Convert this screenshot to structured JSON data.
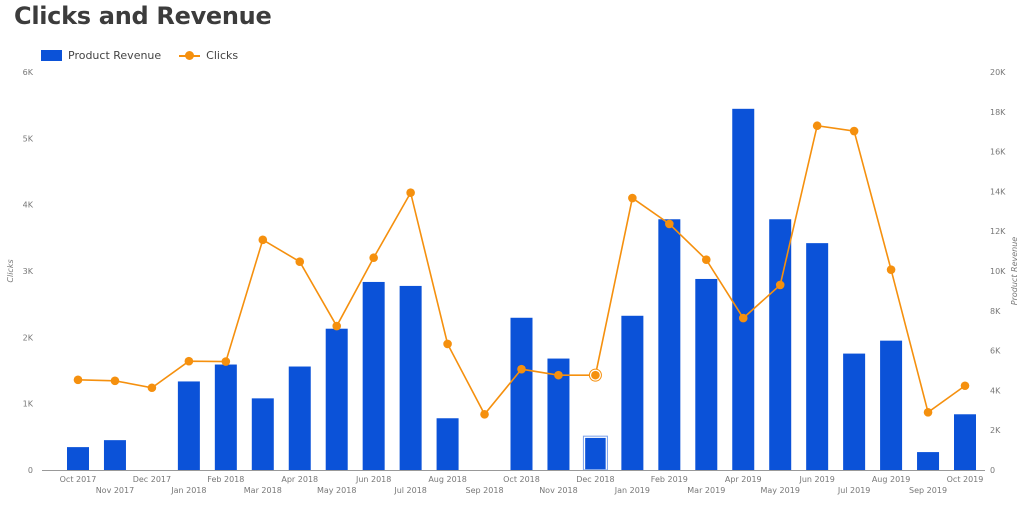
{
  "chart_data": {
    "type": "bar+line",
    "title": "Clicks and Revenue",
    "categories": [
      "Oct 2017",
      "Nov 2017",
      "Dec 2017",
      "Jan 2018",
      "Feb 2018",
      "Mar 2018",
      "Apr 2018",
      "May 2018",
      "Jun 2018",
      "Jul 2018",
      "Aug 2018",
      "Sep 2018",
      "Oct 2018",
      "Nov 2018",
      "Dec 2018",
      "Jan 2019",
      "Feb 2019",
      "Mar 2019",
      "Apr 2019",
      "May 2019",
      "Jun 2019",
      "Jul 2019",
      "Aug 2019",
      "Sep 2019",
      "Oct 2019"
    ],
    "series": [
      {
        "name": "Product Revenue",
        "type": "bar",
        "axis": "right",
        "color": "#0b52d8",
        "values": [
          1150,
          1500,
          0,
          4450,
          5300,
          3600,
          5200,
          7100,
          9450,
          9250,
          2600,
          0,
          7650,
          5600,
          1650,
          7750,
          12600,
          9600,
          18150,
          12600,
          11400,
          5850,
          6500,
          900,
          2800
        ]
      },
      {
        "name": "Clicks",
        "type": "line",
        "axis": "left",
        "color": "#f5900e",
        "values": [
          1360,
          1345,
          1240,
          1640,
          1635,
          3470,
          3140,
          2170,
          3200,
          4180,
          1900,
          840,
          1520,
          1430,
          1430,
          4100,
          3710,
          3170,
          2290,
          2790,
          5190,
          5110,
          3020,
          870,
          1270
        ]
      }
    ],
    "highlighted_category": "Dec 2018",
    "left_axis": {
      "label": "Clicks",
      "ylim": [
        0,
        6000
      ],
      "ticks": [
        "0",
        "1K",
        "2K",
        "3K",
        "4K",
        "5K",
        "6K"
      ],
      "tick_values": [
        0,
        1000,
        2000,
        3000,
        4000,
        5000,
        6000
      ]
    },
    "right_axis": {
      "label": "Product Revenue",
      "ylim": [
        0,
        20000
      ],
      "ticks": [
        "0",
        "2K",
        "4K",
        "6K",
        "8K",
        "10K",
        "12K",
        "14K",
        "16K",
        "18K",
        "20K"
      ],
      "tick_values": [
        0,
        2000,
        4000,
        6000,
        8000,
        10000,
        12000,
        14000,
        16000,
        18000,
        20000
      ]
    },
    "xlabel": "",
    "grid": false,
    "legend_position": "top-left"
  },
  "legend": {
    "revenue_label": "Product Revenue",
    "clicks_label": "Clicks"
  }
}
